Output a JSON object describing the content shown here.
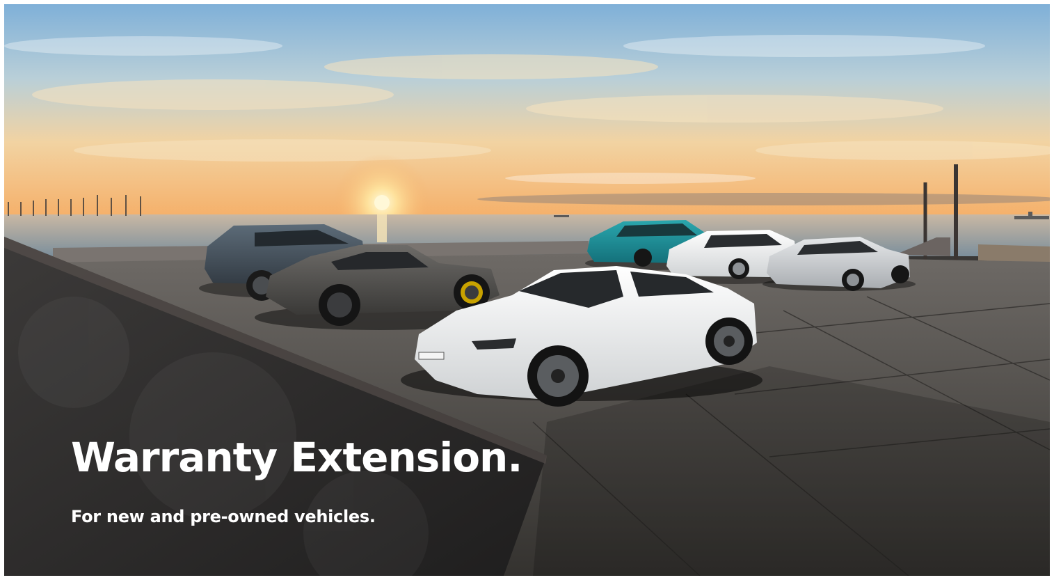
{
  "hero": {
    "title": "Warranty Extension.",
    "subtitle": "For new and pre-owned vehicles.",
    "image": "sunset-seaside-lineup-of-seven-porsche-cars"
  },
  "colors": {
    "text": "#ffffff",
    "sky_top": "#7fb0d8",
    "sky_horizon": "#f5c27a",
    "sun": "#fff3c4",
    "sea": "#8fa7b8",
    "pavement": "#45423f",
    "wall": "#2d2c2b",
    "taycan": "#eeeeee",
    "macan": "#1e8c96"
  }
}
